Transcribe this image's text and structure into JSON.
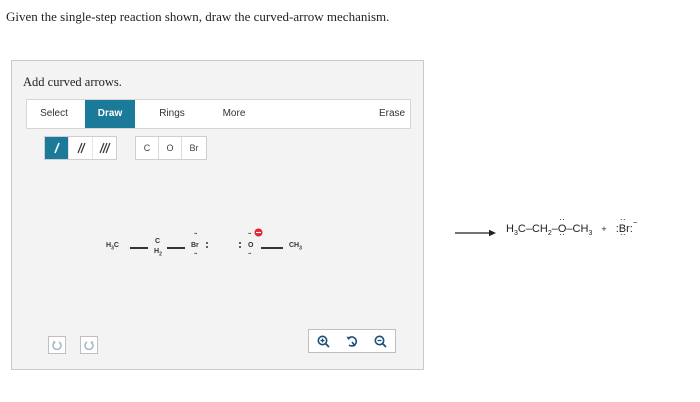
{
  "question": "Given the single-step reaction shown, draw the curved-arrow mechanism.",
  "panel": {
    "title": "Add curved arrows.",
    "tabs": [
      {
        "label": "Select"
      },
      {
        "label": "Draw"
      },
      {
        "label": "Rings"
      },
      {
        "label": "More"
      },
      {
        "label": "Erase"
      }
    ],
    "atoms": [
      "C",
      "O",
      "Br"
    ],
    "reactant": {
      "h3c": "H",
      "h3c_sub": "3",
      "h3c_c": "C",
      "center_c": "C",
      "h2": "H",
      "h2_sub": "2",
      "br": "Br",
      "o": "O",
      "ch3": "CH",
      "ch3_sub": "3",
      "minus": "−"
    }
  },
  "product": {
    "h3c_1": "H",
    "h3c_1_sub": "3",
    "c1": "C",
    "ch2": "CH",
    "ch2_sub": "2",
    "o": "O",
    "ch3": "CH",
    "ch3_sub": "3",
    "plus": "+",
    "br": "Br",
    "minus": "−"
  },
  "colors": {
    "accent": "#1b7a99",
    "anion": "#e0242e"
  }
}
